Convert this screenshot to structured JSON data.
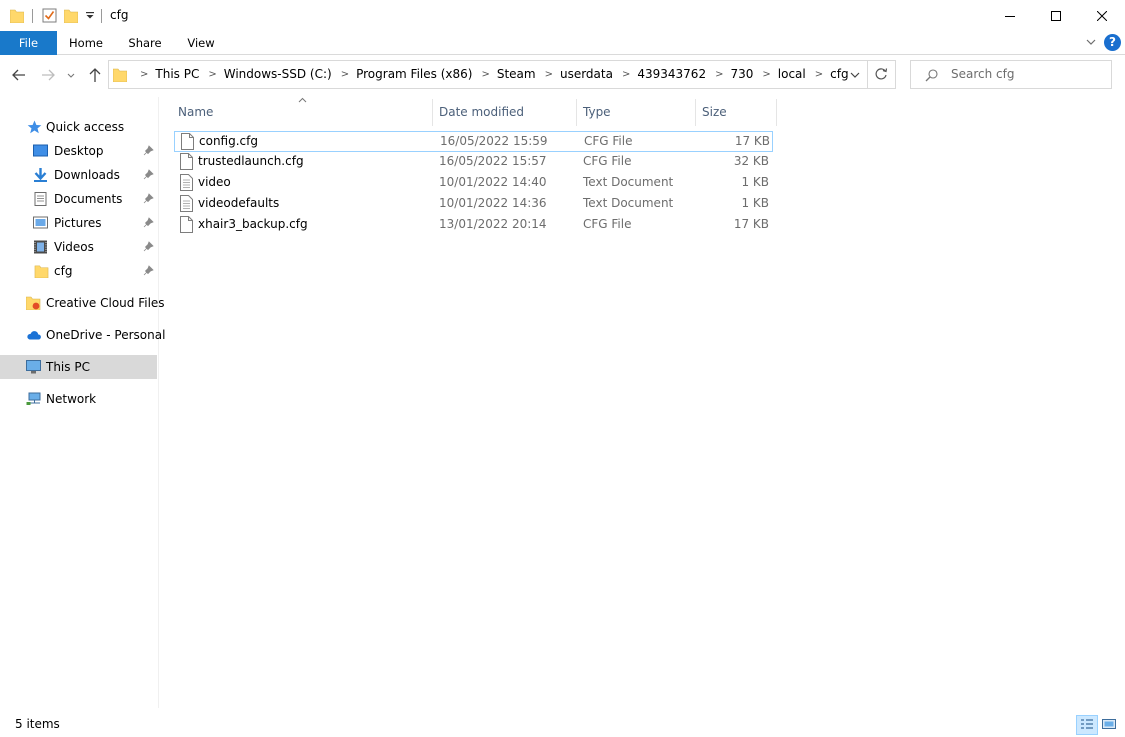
{
  "window": {
    "title": "cfg",
    "controls": {
      "minimize": "minimize",
      "maximize": "maximize",
      "close": "close"
    }
  },
  "ribbon": {
    "tabs": [
      "File",
      "Home",
      "Share",
      "View"
    ],
    "help_label": "?"
  },
  "address": {
    "crumbs": [
      "This PC",
      "Windows-SSD (C:)",
      "Program Files (x86)",
      "Steam",
      "userdata",
      "439343762",
      "730",
      "local",
      "cfg"
    ]
  },
  "search": {
    "placeholder": "Search cfg"
  },
  "nav": {
    "quick_access": "Quick access",
    "pinned": [
      {
        "label": "Desktop",
        "icon": "desktop-icon"
      },
      {
        "label": "Downloads",
        "icon": "downloads-icon"
      },
      {
        "label": "Documents",
        "icon": "documents-icon"
      },
      {
        "label": "Pictures",
        "icon": "pictures-icon"
      },
      {
        "label": "Videos",
        "icon": "videos-icon"
      },
      {
        "label": "cfg",
        "icon": "folder-icon"
      }
    ],
    "creative_cloud": "Creative Cloud Files",
    "onedrive": "OneDrive - Personal",
    "this_pc": "This PC",
    "network": "Network"
  },
  "columns": {
    "name": "Name",
    "date": "Date modified",
    "type": "Type",
    "size": "Size"
  },
  "files": [
    {
      "name": "config.cfg",
      "date": "16/05/2022 15:59",
      "type": "CFG File",
      "size": "17 KB"
    },
    {
      "name": "trustedlaunch.cfg",
      "date": "16/05/2022 15:57",
      "type": "CFG File",
      "size": "32 KB"
    },
    {
      "name": "video",
      "date": "10/01/2022 14:40",
      "type": "Text Document",
      "size": "1 KB"
    },
    {
      "name": "videodefaults",
      "date": "10/01/2022 14:36",
      "type": "Text Document",
      "size": "1 KB"
    },
    {
      "name": "xhair3_backup.cfg",
      "date": "13/01/2022 20:14",
      "type": "CFG File",
      "size": "17 KB"
    }
  ],
  "status": {
    "item_count": "5 items"
  },
  "colors": {
    "accent": "#1979ca",
    "selected_nav": "#d9d9d9",
    "header_text": "#4c607a",
    "folder": "#ffd86b"
  }
}
